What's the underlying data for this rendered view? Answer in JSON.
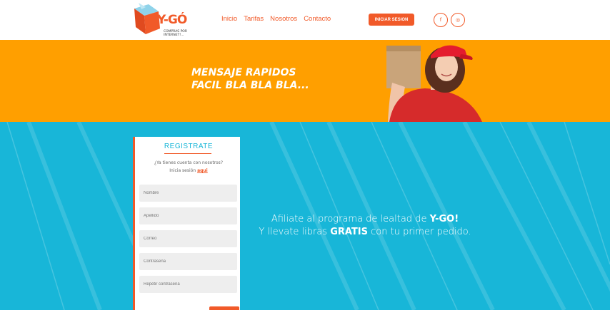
{
  "logo": {
    "brand": "Y-GÓ",
    "tagline": "COMPRAS POR INTERNET!..."
  },
  "nav": {
    "items": [
      "Inicio",
      "Tarifas",
      "Nosotros",
      "Contacto"
    ]
  },
  "header": {
    "login_label": "INICIAR SESION",
    "facebook_glyph": "f",
    "instagram_glyph": "◎"
  },
  "banner": {
    "headline": "MENSAJE RAPIDOS\nFACIL BLA BLA BLA..."
  },
  "register": {
    "title": "REGISTRATE",
    "question": "¿Ya tienes cuenta con nosotros?",
    "login_prefix": "Inicia sesión",
    "login_link": "aqui",
    "fields": {
      "name_placeholder": "Nombre",
      "lastname_placeholder": "Apellido",
      "email_placeholder": "Correo",
      "password_placeholder": "Contraseña",
      "password_repeat_placeholder": "Repetir contraseña"
    }
  },
  "promo": {
    "line1_prefix": "Afiliate al programa de lealtad de",
    "line1_brand": "Y-GO!",
    "line2_prefix": "Y llevate libras",
    "line2_bold": "GRATIS",
    "line2_suffix": "con tu primer pedido."
  },
  "colors": {
    "accent": "#f15a29",
    "banner": "#ff9f00",
    "main_bg": "#18b6d8"
  },
  "icons": [
    "logo-box-icon",
    "facebook-icon",
    "instagram-icon"
  ]
}
